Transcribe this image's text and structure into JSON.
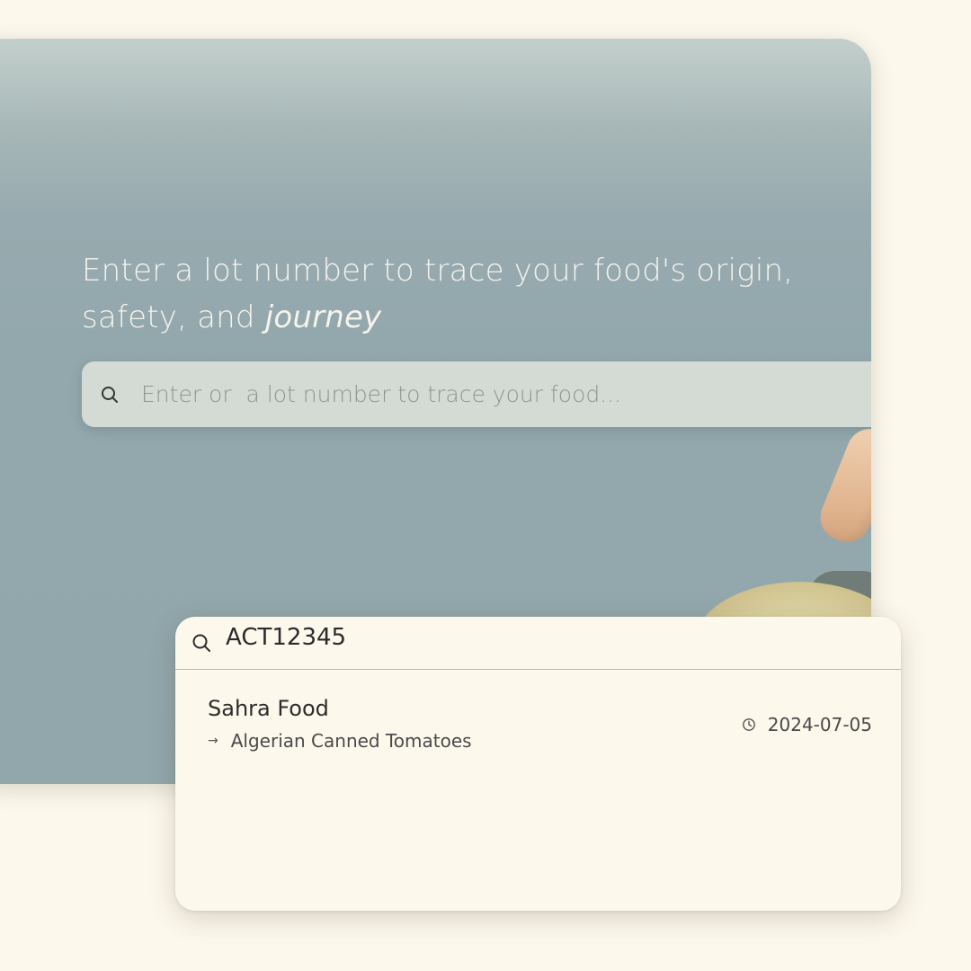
{
  "hero": {
    "title_main": "Enter a lot number to trace your food's origin, safety, and ",
    "title_emphasis": "journey",
    "search_placeholder": "Enter or  a lot number to trace your food..."
  },
  "popup": {
    "query": "ACT12345",
    "results": [
      {
        "name": "Sahra Food",
        "product": "Algerian Canned Tomatoes",
        "date": "2024-07-05"
      }
    ]
  },
  "icons": {
    "search": "search-icon",
    "arrow": "arrow-right-icon",
    "clock": "clock-icon"
  },
  "colors": {
    "page_background": "#fdf8ec",
    "hero_background": "#92a7ac",
    "hero_text": "#f5f3ec",
    "search_bar": "#d4dbd4",
    "popup_background": "#fdf8ec"
  }
}
